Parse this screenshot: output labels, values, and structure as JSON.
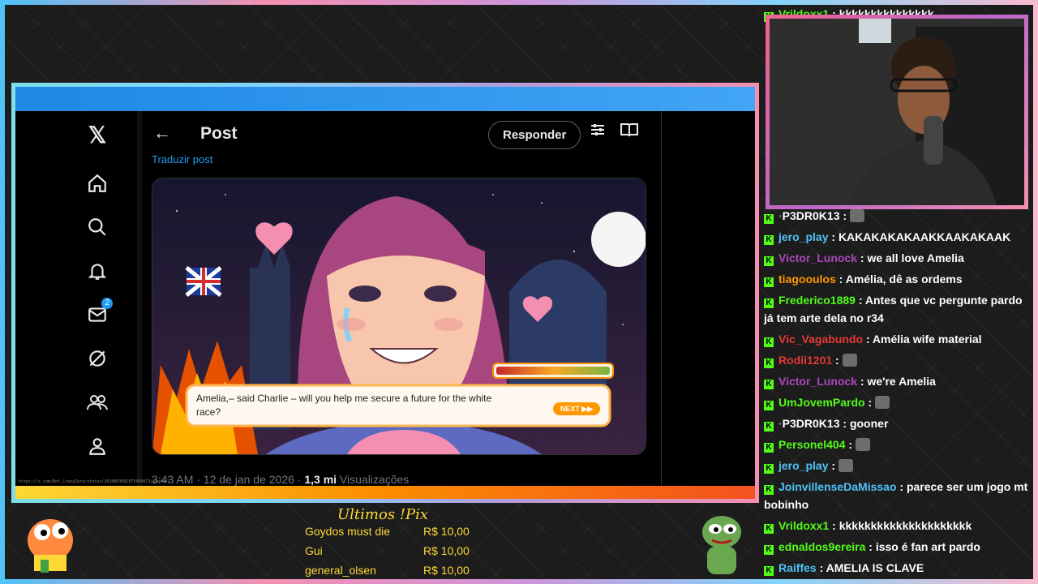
{
  "browser": {
    "status_url": "https://x.com/Bot_CrazyZero/status/2010893082875949073/photo/1"
  },
  "x_nav": {
    "notifications_badge": "2",
    "icons": [
      "x-logo-icon",
      "home-icon",
      "search-icon",
      "bell-icon",
      "mail-icon",
      "grok-icon",
      "people-icon",
      "profile-icon"
    ]
  },
  "post": {
    "title": "Post",
    "respond_label": "Responder",
    "translate_label": "Traduzir post",
    "timestamp": "3:43 AM · 12 de jan de 2026 · ",
    "views_count": "1,3 mi",
    "views_label": " Visualizações",
    "game_dialogue": "Amelia,– said Charlie – will you help me secure a future for the white race?",
    "game_next_label": "NEXT"
  },
  "chat": [
    {
      "user": "Vrildoxx1",
      "color": "#53fc18",
      "text": "kkkkkkkkkkkkkkk"
    },
    {
      "user": "P3DR0K13",
      "color": "#ffffff",
      "text": "",
      "emote": true,
      "prefix": "·"
    },
    {
      "user": "jero_play",
      "color": "#4fc3f7",
      "text": "KAKAKAKAKAAKKAAKAKAAK"
    },
    {
      "user": "Victor_Lunock",
      "color": "#ab47bc",
      "text": "we all love Amelia"
    },
    {
      "user": "tiagooulos",
      "color": "#ff9800",
      "text": "Amélia, dê as ordems"
    },
    {
      "user": "Frederico1889",
      "color": "#53fc18",
      "text": "Antes que vc pergunte pardo já tem arte dela no r34"
    },
    {
      "user": "Vic_Vagabundo",
      "color": "#e53935",
      "text": "Amélia wife material"
    },
    {
      "user": "Rodii1201",
      "color": "#e53935",
      "text": "",
      "emote": true
    },
    {
      "user": "Victor_Lunock",
      "color": "#ab47bc",
      "text": "we're Amelia"
    },
    {
      "user": "UmJovemPardo",
      "color": "#53fc18",
      "text": "",
      "emote": true
    },
    {
      "user": "P3DR0K13",
      "color": "#ffffff",
      "text": "gooner",
      "prefix": "·"
    },
    {
      "user": "Personel404",
      "color": "#53fc18",
      "text": "",
      "emote": true
    },
    {
      "user": "jero_play",
      "color": "#4fc3f7",
      "text": "",
      "emote": true
    },
    {
      "user": "JoinvillenseDaMissao",
      "color": "#4fc3f7",
      "text": "parece ser um jogo mt bobinho"
    },
    {
      "user": "Vrildoxx1",
      "color": "#53fc18",
      "text": "kkkkkkkkkkkkkkkkkkkkk"
    },
    {
      "user": "ednaldos9ereira",
      "color": "#53fc18",
      "text": "isso é fan art pardo"
    },
    {
      "user": "Raiffes",
      "color": "#4fc3f7",
      "text": "AMELIA IS CLAVE"
    }
  ],
  "pix": {
    "title": "Ultimos !Pix",
    "rows": [
      {
        "name": "Goydos must die",
        "amount": "R$ 10,00"
      },
      {
        "name": "Gui",
        "amount": "R$ 10,00"
      },
      {
        "name": "general_olsen",
        "amount": "R$ 10,00"
      }
    ]
  }
}
